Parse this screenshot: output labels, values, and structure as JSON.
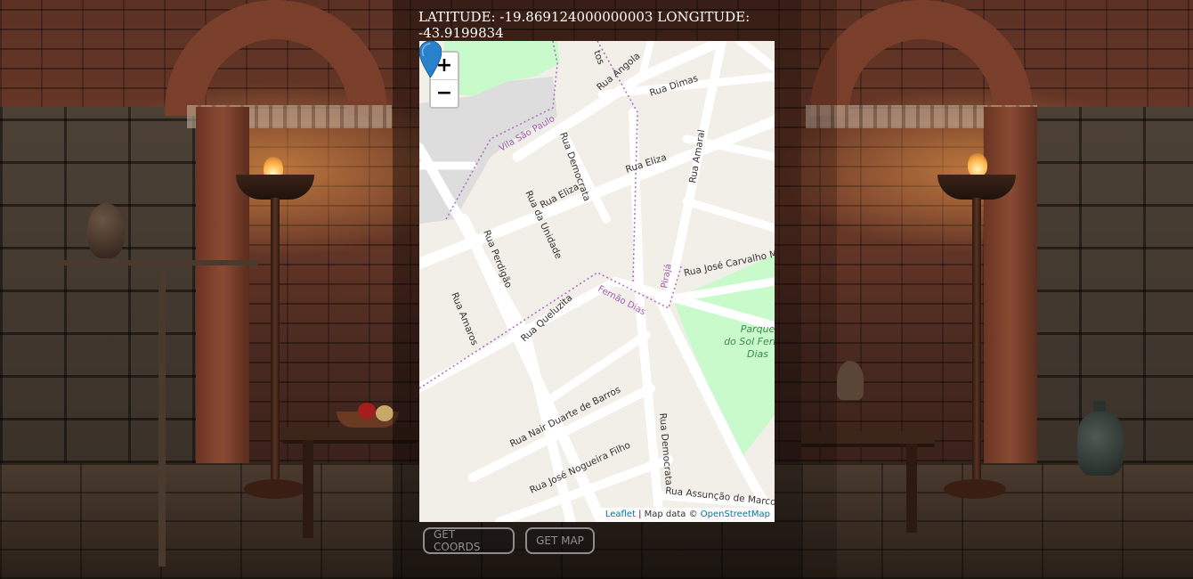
{
  "location": {
    "latitude_label": "LATITUDE:",
    "latitude_value": "-19.869124000000003",
    "longitude_label": "LONGITUDE:",
    "longitude_value": "-43.9199834"
  },
  "map": {
    "zoom_in_label": "+",
    "zoom_out_label": "−",
    "marker_icon": "map-pin-icon",
    "marker_color": "#2a81cb",
    "park_color": "#c8facc",
    "streets": {
      "rua_angola": "Rua Angola",
      "rua_dimas": "Rua Dimas",
      "rua_democrata_top": "Rua Democrata",
      "rua_eliza_left": "Rua Eliza",
      "rua_eliza_right": "Rua Eliza",
      "rua_amaral": "Rua Amaral",
      "rua_da_unidade": "Rua da Unidade",
      "rua_perdigao": "Rua Perdigão",
      "rua_amaros": "Rua Amaros",
      "rua_queluzita": "Rua Queluzita",
      "rua_jose_carvalho": "Rua José Carvalho M",
      "rua_nair": "Rua Nair Duarte de Barros",
      "rua_jose_nogueira": "Rua José Nogueira Filho",
      "rua_democrata_bottom": "Rua Democrata",
      "rua_assuncao": "Rua Assunção de Marco",
      "partial_top": "tos"
    },
    "boundaries": {
      "vila_sao_paulo": "Vila São Paulo",
      "fernao_dias": "Fernão Dias",
      "piraja": "Pirajá"
    },
    "park": {
      "line1": "Parque",
      "line2": "do Sol Ferr",
      "line3": "Dias"
    },
    "attribution": {
      "leaflet": "Leaflet",
      "separator": " | Map data © ",
      "osm": "OpenStreetMap"
    }
  },
  "buttons": {
    "get_coords": "GET COORDS",
    "get_map": "GET MAP"
  }
}
